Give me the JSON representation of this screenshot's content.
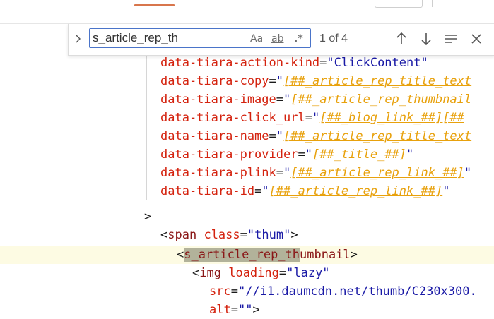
{
  "find": {
    "query": "s_article_rep_th",
    "match_case_label": "Aa",
    "whole_word_label": "ab",
    "regex_label": ".*",
    "result_count": "1 of 4",
    "icons": [
      "expand-chevron-icon",
      "arrow-up-icon",
      "arrow-down-icon",
      "selection-lines-icon",
      "close-icon"
    ]
  },
  "code": {
    "lines": [
      {
        "attr": "data-tiara-action-kind",
        "eq": "=",
        "value": "\"ClickContent\""
      },
      {
        "attr": "data-tiara-copy",
        "eq": "=",
        "q1": "\"",
        "tpl": "[##_article_rep_title_text"
      },
      {
        "attr": "data-tiara-image",
        "eq": "=",
        "q1": "\"",
        "tpl": "[##_article_rep_thumbnail"
      },
      {
        "attr": "data-tiara-click_url",
        "eq": "=",
        "q1": "\"",
        "tpl": "[##_blog_link_##][##"
      },
      {
        "attr": "data-tiara-name",
        "eq": "=",
        "q1": "\"",
        "tpl": "[##_article_rep_title_text"
      },
      {
        "attr": "data-tiara-provider",
        "eq": "=",
        "q1": "\"",
        "tpl": "[##_title_##]",
        "q2": "\""
      },
      {
        "attr": "data-tiara-plink",
        "eq": "=",
        "q1": "\"",
        "tpl": "[##_article_rep_link_##]",
        "q2": "\""
      },
      {
        "attr": "data-tiara-id",
        "eq": "=",
        "q1": "\"",
        "tpl": "[##_article_rep_link_##]",
        "q2": "\""
      }
    ],
    "close_bracket": ">",
    "span_open": "<",
    "span_tag": "span",
    "span_attr": "class",
    "span_eq": "=",
    "span_value": "\"thum\"",
    "span_close": ">",
    "hl_open": "<",
    "hl_match": "s_article_rep_th",
    "hl_rest": "umbnail",
    "hl_close": ">",
    "img_open": "<",
    "img_tag": "img",
    "img_attr": "loading",
    "img_eq": "=",
    "img_value": "\"lazy\"",
    "src_attr": "src",
    "src_eq": "=",
    "src_q": "\"",
    "src_url": "//i1.daumcdn.net/thumb/C230x300.",
    "alt_attr": "alt",
    "alt_eq": "=",
    "alt_value": "\"\"",
    "alt_close": ">"
  },
  "colors": {
    "attribute": "#d4220e",
    "string": "#1a1aa6",
    "template": "#e8a10c",
    "tag_name": "#8a1717",
    "match_highlight": "#b2b29a",
    "line_highlight": "#fdfbe3",
    "tab_accent": "#d8764c",
    "input_border": "#4a74c9"
  }
}
